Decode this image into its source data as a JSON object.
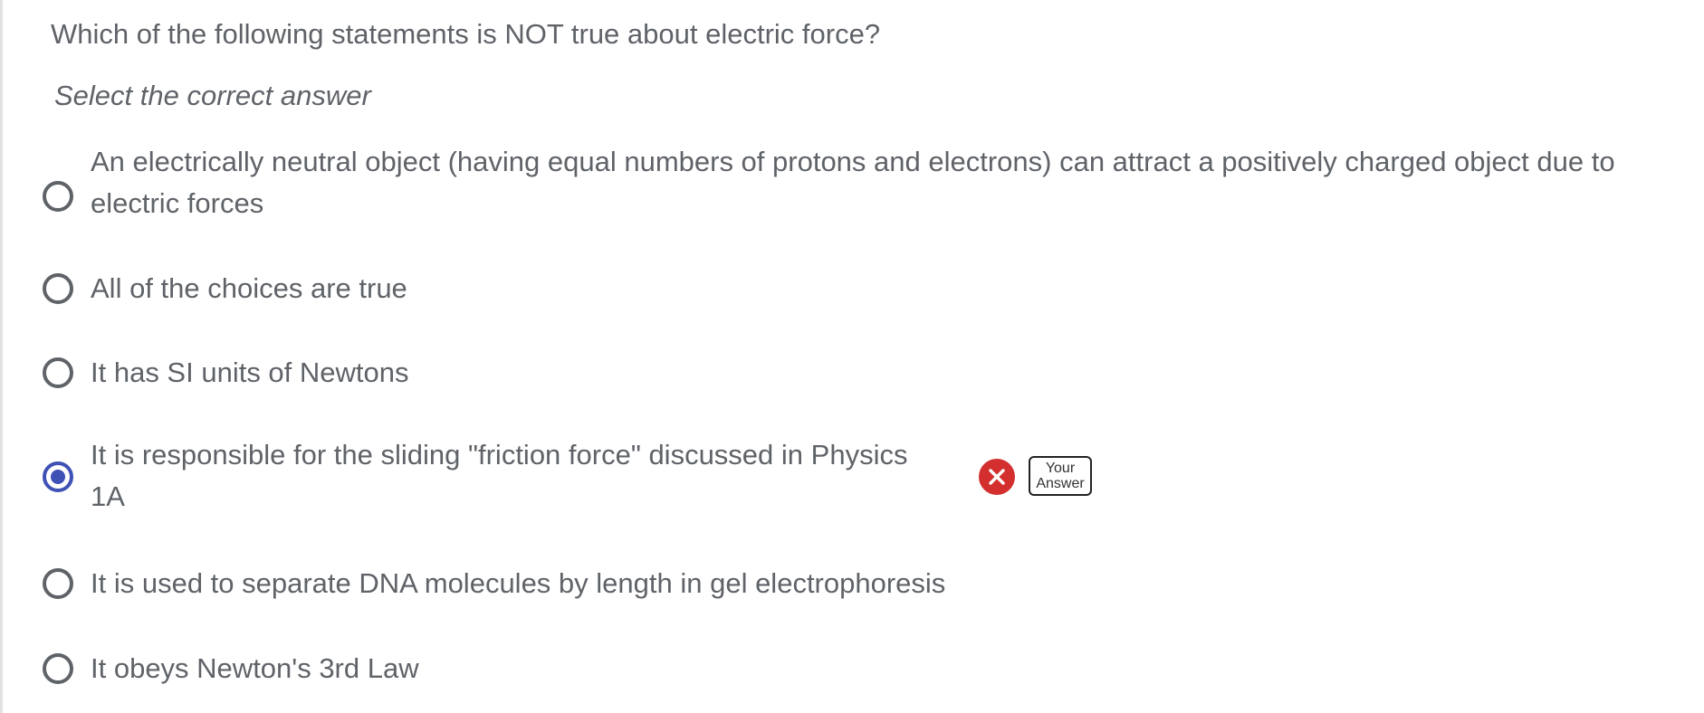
{
  "question": {
    "text": "Which of the following statements is NOT true about electric force?",
    "instruction": "Select the correct answer"
  },
  "options": [
    {
      "line1": "An electrically neutral object (having equal numbers of protons and electrons) can attract a positively charged object due to",
      "line2": "electric forces",
      "selected": false
    },
    {
      "line1": "All of the choices are true",
      "selected": false
    },
    {
      "line1": "It has SI units of Newtons",
      "selected": false
    },
    {
      "line1": "It is responsible for the sliding \"friction force\" discussed in Physics",
      "line2": "1A",
      "selected": true
    },
    {
      "line1": "It is used to separate DNA molecules by length in gel electrophoresis",
      "selected": false
    },
    {
      "line1": "It obeys Newton's 3rd Law",
      "selected": false
    }
  ],
  "feedback": {
    "icon": "close-icon",
    "status_color": "#d32f2f",
    "badge_line1": "Your",
    "badge_line2": "Answer"
  },
  "colors": {
    "text": "#5f6368",
    "selected_accent": "#3f51b5"
  }
}
